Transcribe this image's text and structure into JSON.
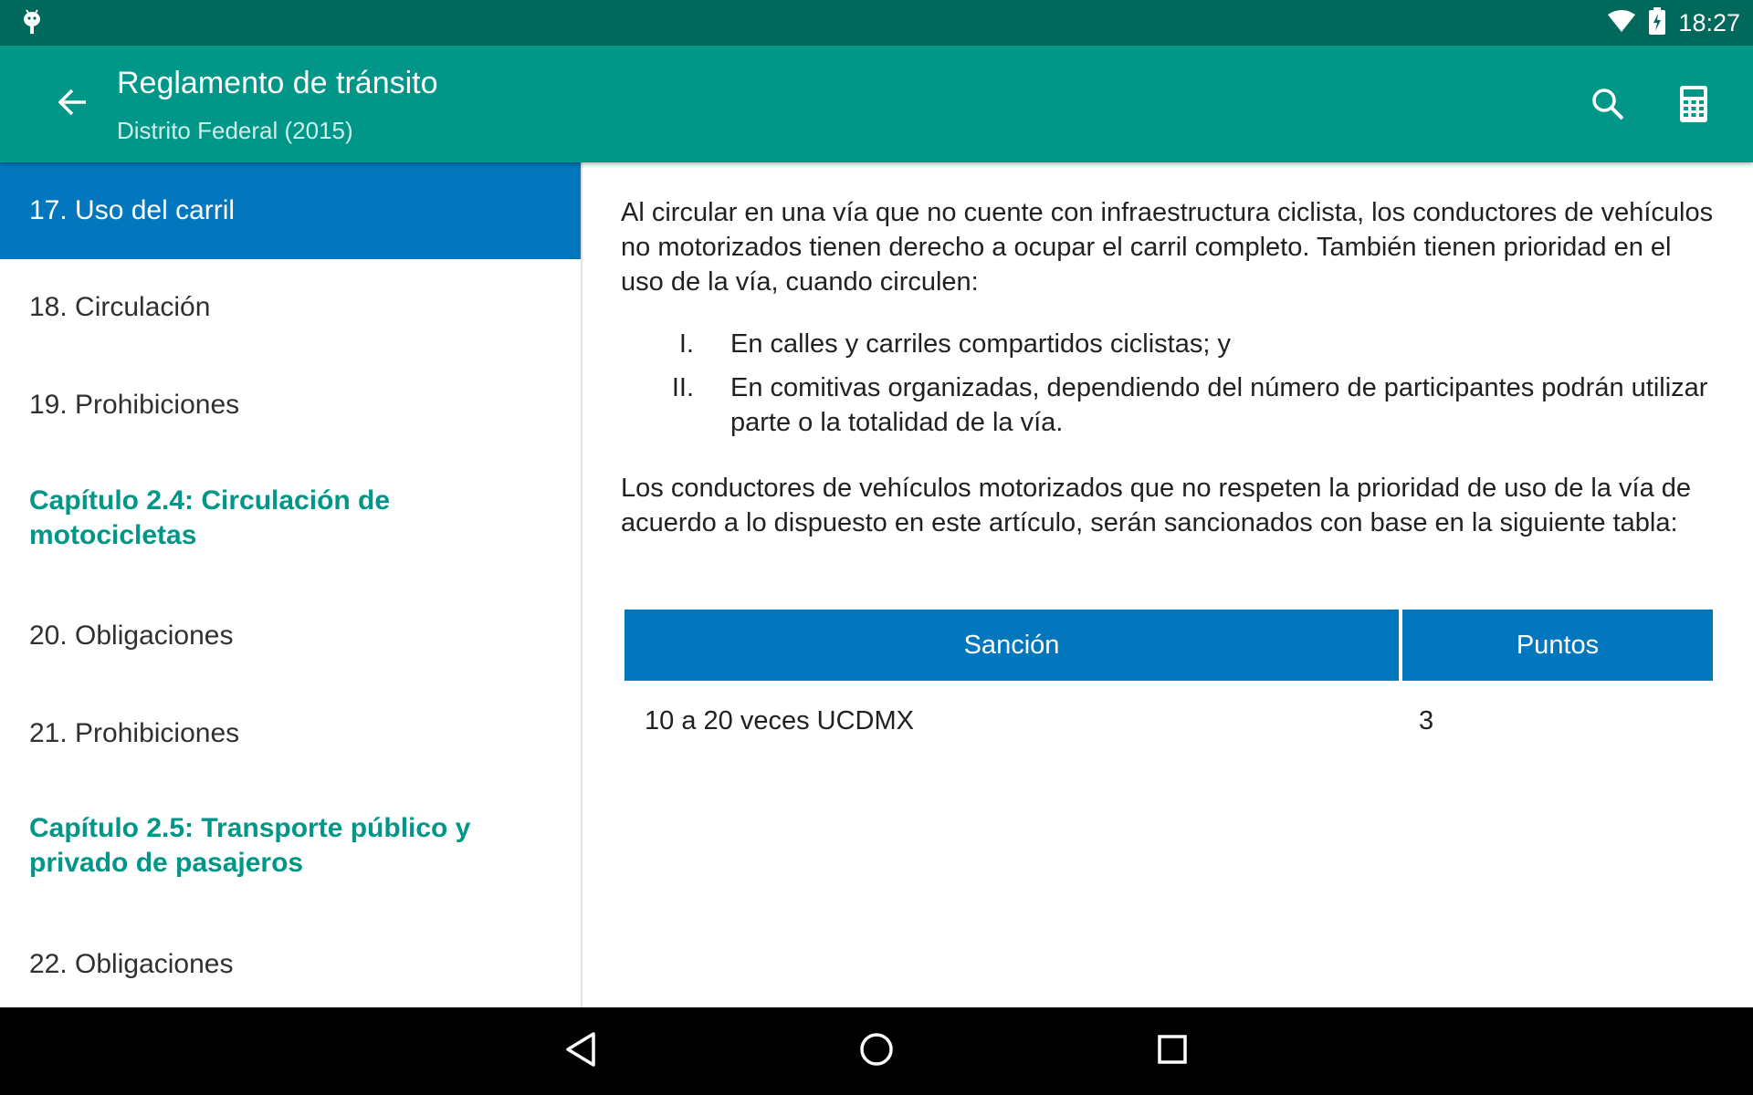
{
  "status_bar": {
    "time": "18:27",
    "icons": [
      "android-debug-icon",
      "wifi-icon",
      "battery-charging-icon"
    ]
  },
  "app_bar": {
    "title": "Reglamento de tránsito",
    "subtitle": "Distrito Federal (2015)",
    "actions": [
      "search-icon",
      "calculator-icon"
    ],
    "background": "#009688"
  },
  "sidebar": {
    "items": [
      {
        "type": "article",
        "label": "17. Uso del carril",
        "selected": true
      },
      {
        "type": "article",
        "label": "18. Circulación"
      },
      {
        "type": "article",
        "label": "19. Prohibiciones"
      },
      {
        "type": "chapter",
        "label": "Capítulo 2.4: Circulación de motocicletas"
      },
      {
        "type": "article",
        "label": "20. Obligaciones"
      },
      {
        "type": "article",
        "label": "21. Prohibiciones"
      },
      {
        "type": "chapter",
        "label": "Capítulo 2.5: Transporte público y privado de pasajeros"
      },
      {
        "type": "article",
        "label": "22. Obligaciones"
      }
    ],
    "selected_color": "#0277bd",
    "chapter_color": "#009688"
  },
  "content": {
    "intro": "Al circular en una vía que no cuente con infraestructura ciclista, los conductores de vehículos no motorizados tienen derecho a ocupar el carril completo. También tienen prioridad en el uso de la vía, cuando circulen:",
    "list": [
      {
        "num": "I.",
        "text": "En calles y carriles compartidos ciclistas; y"
      },
      {
        "num": "II.",
        "text": "En comitivas organizadas, dependiendo del número de participantes podrán utilizar parte o la totalidad de la vía."
      }
    ],
    "closing": "Los conductores de vehículos motorizados que no respeten la prioridad de uso de la vía de acuerdo a lo dispuesto en este artículo, serán sancionados con base en la siguiente tabla:",
    "table": {
      "headers": [
        "Sanción",
        "Puntos"
      ],
      "rows": [
        [
          "10 a 20 veces UCDMX",
          "3"
        ]
      ],
      "header_color": "#0277bd"
    }
  },
  "nav_bar": {
    "buttons": [
      "back-icon",
      "home-icon",
      "recents-icon"
    ]
  }
}
